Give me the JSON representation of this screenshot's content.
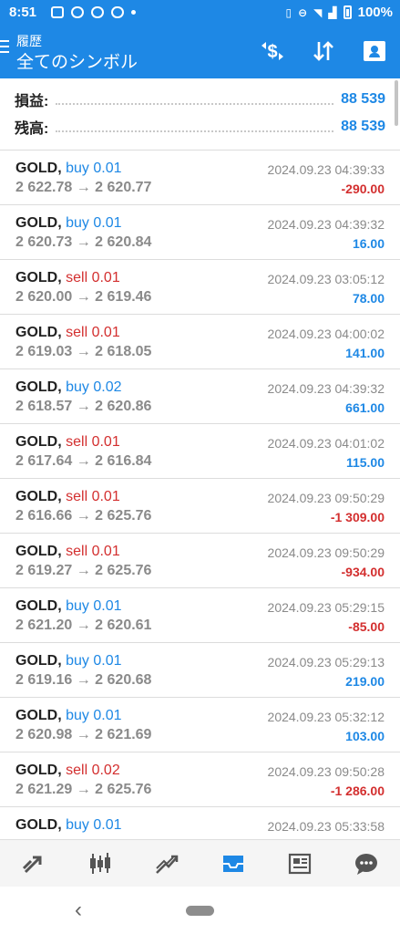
{
  "status_bar": {
    "time": "8:51",
    "battery": "100%"
  },
  "app_bar": {
    "subtitle": "履歴",
    "title": "全てのシンボル",
    "accent": "#1e88e5"
  },
  "summary": {
    "profit_label": "損益:",
    "profit_value": "88 539",
    "balance_label": "残高:",
    "balance_value": "88 539"
  },
  "deals": [
    {
      "symbol": "GOLD,",
      "side": "buy",
      "side_text": "buy 0.01",
      "prices": "2 622.78 → 2 620.77",
      "time": "2024.09.23 04:39:33",
      "profit": "-290.00",
      "sign": "neg"
    },
    {
      "symbol": "GOLD,",
      "side": "buy",
      "side_text": "buy 0.01",
      "prices": "2 620.73 → 2 620.84",
      "time": "2024.09.23 04:39:32",
      "profit": "16.00",
      "sign": "pos"
    },
    {
      "symbol": "GOLD,",
      "side": "sell",
      "side_text": "sell 0.01",
      "prices": "2 620.00 → 2 619.46",
      "time": "2024.09.23 03:05:12",
      "profit": "78.00",
      "sign": "pos"
    },
    {
      "symbol": "GOLD,",
      "side": "sell",
      "side_text": "sell 0.01",
      "prices": "2 619.03 → 2 618.05",
      "time": "2024.09.23 04:00:02",
      "profit": "141.00",
      "sign": "pos"
    },
    {
      "symbol": "GOLD,",
      "side": "buy",
      "side_text": "buy 0.02",
      "prices": "2 618.57 → 2 620.86",
      "time": "2024.09.23 04:39:32",
      "profit": "661.00",
      "sign": "pos"
    },
    {
      "symbol": "GOLD,",
      "side": "sell",
      "side_text": "sell 0.01",
      "prices": "2 617.64 → 2 616.84",
      "time": "2024.09.23 04:01:02",
      "profit": "115.00",
      "sign": "pos"
    },
    {
      "symbol": "GOLD,",
      "side": "sell",
      "side_text": "sell 0.01",
      "prices": "2 616.66 → 2 625.76",
      "time": "2024.09.23 09:50:29",
      "profit": "-1 309.00",
      "sign": "neg"
    },
    {
      "symbol": "GOLD,",
      "side": "sell",
      "side_text": "sell 0.01",
      "prices": "2 619.27 → 2 625.76",
      "time": "2024.09.23 09:50:29",
      "profit": "-934.00",
      "sign": "neg"
    },
    {
      "symbol": "GOLD,",
      "side": "buy",
      "side_text": "buy 0.01",
      "prices": "2 621.20 → 2 620.61",
      "time": "2024.09.23 05:29:15",
      "profit": "-85.00",
      "sign": "neg"
    },
    {
      "symbol": "GOLD,",
      "side": "buy",
      "side_text": "buy 0.01",
      "prices": "2 619.16 → 2 620.68",
      "time": "2024.09.23 05:29:13",
      "profit": "219.00",
      "sign": "pos"
    },
    {
      "symbol": "GOLD,",
      "side": "buy",
      "side_text": "buy 0.01",
      "prices": "2 620.98 → 2 621.69",
      "time": "2024.09.23 05:32:12",
      "profit": "103.00",
      "sign": "pos"
    },
    {
      "symbol": "GOLD,",
      "side": "sell",
      "side_text": "sell 0.02",
      "prices": "2 621.29 → 2 625.76",
      "time": "2024.09.23 09:50:28",
      "profit": "-1 286.00",
      "sign": "neg"
    },
    {
      "symbol": "GOLD,",
      "side": "buy",
      "side_text": "buy 0.01",
      "prices": "",
      "time": "2024.09.23 05:33:58",
      "profit": "",
      "sign": "pos"
    }
  ],
  "tabs": [
    {
      "icon": "quotes-arrows-icon"
    },
    {
      "icon": "candlestick-chart-icon"
    },
    {
      "icon": "trade-icon"
    },
    {
      "icon": "history-inbox-icon",
      "active": true
    },
    {
      "icon": "news-icon"
    },
    {
      "icon": "chat-icon"
    }
  ]
}
